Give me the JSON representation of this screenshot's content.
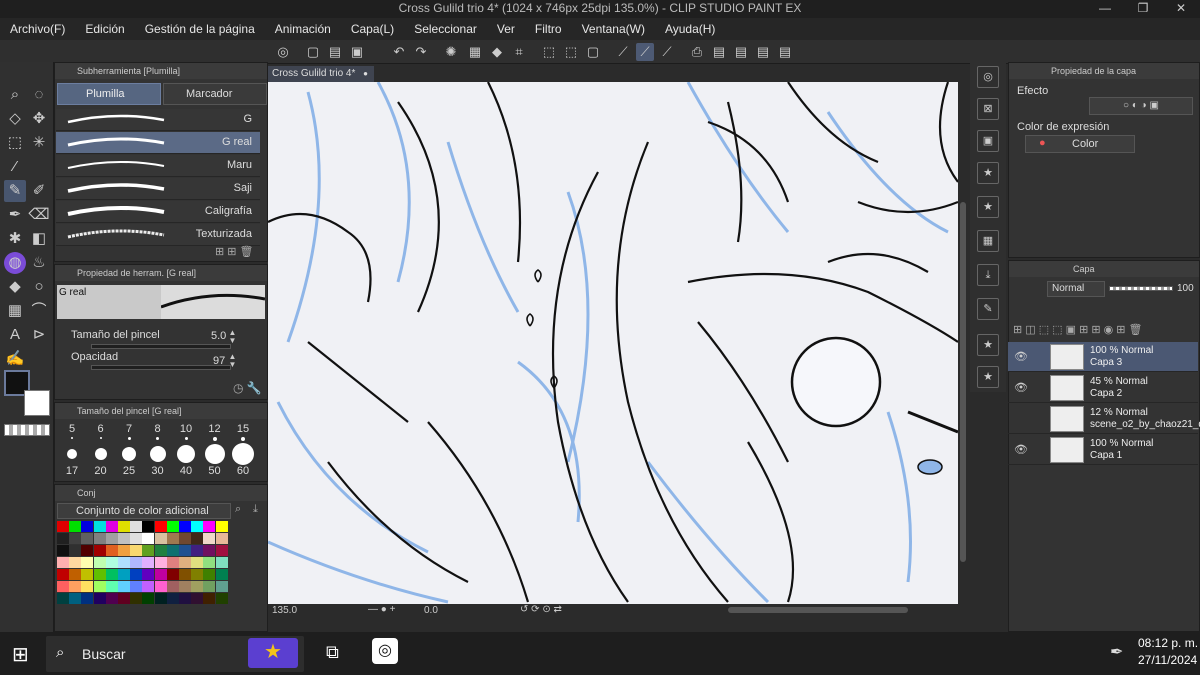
{
  "window": {
    "title": "Cross Gulild trio 4* (1024 x 746px 25dpi 135.0%) - CLIP STUDIO PAINT EX",
    "minimize": "—",
    "restore": "❐",
    "close": "✕"
  },
  "menu": [
    "Archivo(F)",
    "Edición",
    "Gestión de la página",
    "Animación",
    "Capa(L)",
    "Seleccionar",
    "Ver",
    "Filtro",
    "Ventana(W)",
    "Ayuda(H)"
  ],
  "canvas_tab": {
    "label": "Cross Gulild trio 4*",
    "close": "●"
  },
  "subtool": {
    "header": "Subherramienta [Plumilla]",
    "tabs": [
      "Plumilla",
      "Marcador"
    ],
    "brushes": [
      "G",
      "G real",
      "Maru",
      "Saji",
      "Caligrafía",
      "Texturizada"
    ],
    "selected_index": 1
  },
  "tool_property": {
    "header": "Propiedad de herram. [G real]",
    "preview_label": "G real",
    "brush_size_label": "Tamaño del pincel",
    "brush_size_value": "5.0",
    "opacity_label": "Opacidad",
    "opacity_value": "97"
  },
  "brush_size_panel": {
    "header": "Tamaño del pincel [G real]",
    "sizes_row1": [
      "5",
      "6",
      "7",
      "8",
      "10",
      "12",
      "15"
    ],
    "sizes_row2": [
      "17",
      "20",
      "25",
      "30",
      "40",
      "50",
      "60"
    ]
  },
  "color_set": {
    "tab_label": "Conj",
    "set_name": "Conjunto de color adicional",
    "colors": [
      "#e00000",
      "#00e000",
      "#0000e0",
      "#00e0e0",
      "#e000e0",
      "#e0e000",
      "#e0e0e0",
      "#000000",
      "#ff0000",
      "#00ff00",
      "#0000ff",
      "#00ffff",
      "#ff00ff",
      "#ffff00",
      "#202020",
      "#404040",
      "#606060",
      "#808080",
      "#a0a0a0",
      "#c0c0c0",
      "#e0e0e0",
      "#ffffff",
      "#d8c0a0",
      "#a07850",
      "#704830",
      "#402818",
      "#f0d8c8",
      "#e8b898",
      "#101010",
      "#303030",
      "#500000",
      "#a00000",
      "#e06020",
      "#f0a040",
      "#f8d870",
      "#60a020",
      "#208040",
      "#107070",
      "#205090",
      "#402080",
      "#701060",
      "#a01040",
      "#ffb0b0",
      "#ffd8a0",
      "#ffffb0",
      "#c0ffb0",
      "#b0ffe0",
      "#b0e0ff",
      "#b0b8ff",
      "#e0b0ff",
      "#ffb0e0",
      "#e08080",
      "#e0b080",
      "#e0e080",
      "#90e080",
      "#80e0c0",
      "#c00000",
      "#c06000",
      "#c0c000",
      "#60c000",
      "#00c060",
      "#00a0c0",
      "#0040c0",
      "#6000c0",
      "#c000a0",
      "#800000",
      "#805000",
      "#808000",
      "#408000",
      "#008050",
      "#ff6060",
      "#ffa060",
      "#ffe060",
      "#a0ff60",
      "#60ffb0",
      "#60d0ff",
      "#6080ff",
      "#c060ff",
      "#ff60d0",
      "#a06060",
      "#a08060",
      "#a0a060",
      "#70a060",
      "#60a090",
      "#004040",
      "#006080",
      "#003080",
      "#200060",
      "#500050",
      "#600020",
      "#303000",
      "#004000",
      "#002020",
      "#102040",
      "#201040",
      "#301030",
      "#402000",
      "#204000"
    ]
  },
  "navigator": {
    "zoom": "135.0",
    "angle": "0.0"
  },
  "layer_property": {
    "header": "Propiedad de la capa",
    "effect_label": "Efecto",
    "expression_label": "Color de expresión",
    "expression_value": "Color"
  },
  "layers_panel": {
    "header": "Capa",
    "blend_mode": "Normal",
    "opacity": "100",
    "layers": [
      {
        "line1": "100 % Normal",
        "line2": "Capa 3",
        "selected": true,
        "visible": true
      },
      {
        "line1": "45 % Normal",
        "line2": "Capa 2",
        "selected": false,
        "visible": true
      },
      {
        "line1": "12 % Normal",
        "line2": "scene_o2_by_chaoz21_d5",
        "selected": false,
        "visible": false
      },
      {
        "line1": "100 % Normal",
        "line2": "Capa 1",
        "selected": false,
        "visible": true
      }
    ]
  },
  "taskbar": {
    "search_label": "Buscar",
    "time": "08:12 p. m.",
    "date": "27/11/2024"
  },
  "colors": {
    "accent": "#5b6a86",
    "main_color": "#111111",
    "sub_color": "#ffffff",
    "selected_tool": "#7b4cd8"
  }
}
